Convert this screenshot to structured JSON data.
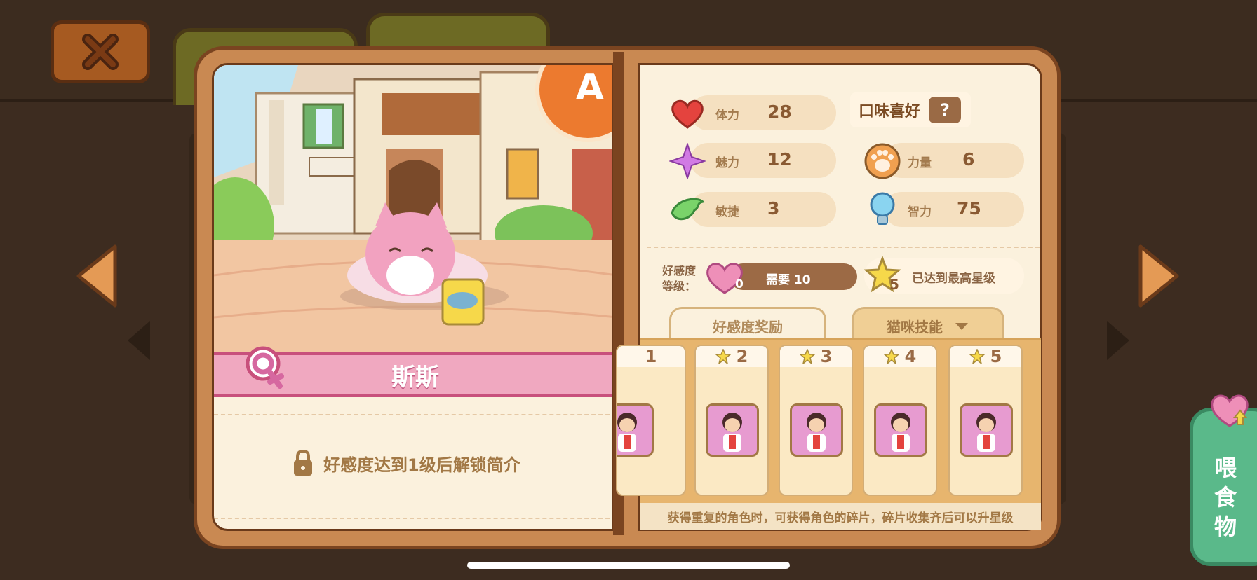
{
  "topbar": {
    "close_label": "close"
  },
  "character": {
    "name": "斯斯",
    "grade": "A",
    "locked_description": "好感度达到1级后解锁简介"
  },
  "stats": [
    {
      "label": "体力",
      "value": "28",
      "icon": "heart-icon"
    },
    {
      "label": "魅力",
      "value": "12",
      "icon": "sparkle-icon"
    },
    {
      "label": "力量",
      "value": "6",
      "icon": "paw-icon"
    },
    {
      "label": "敏捷",
      "value": "3",
      "icon": "wing-icon"
    },
    {
      "label": "智力",
      "value": "75",
      "icon": "lightbulb-icon"
    }
  ],
  "taste": {
    "label": "口味喜好",
    "value": "?"
  },
  "affinity": {
    "label": "好感度等级：",
    "level": "0",
    "requirement": "需要 10",
    "star_level": "5",
    "max_text": "已达到最高星级"
  },
  "tabs": {
    "reward": "好感度奖励",
    "skill": "猫咪技能"
  },
  "reward_cards": [
    {
      "level": "1"
    },
    {
      "level": "2"
    },
    {
      "level": "3"
    },
    {
      "level": "4"
    },
    {
      "level": "5"
    }
  ],
  "footer_note": "获得重复的角色时，可获得角色的碎片，碎片收集齐后可以升星级",
  "feed_button": {
    "label": "喂食物"
  },
  "colors": {
    "accent": "#ec7a2f",
    "pink": "#f0a8c0",
    "green": "#5ab98a",
    "wood": "#c98952"
  }
}
